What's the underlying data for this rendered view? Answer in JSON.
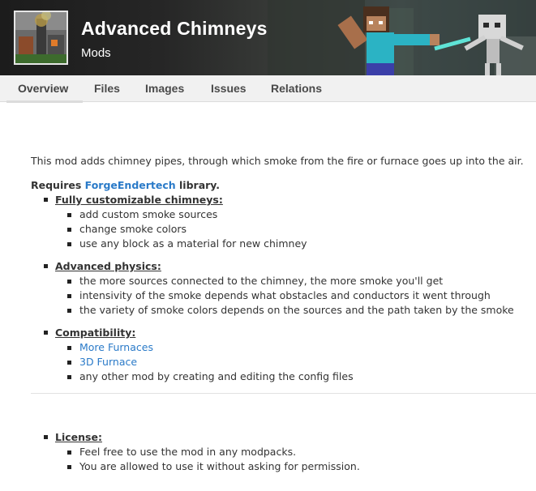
{
  "header": {
    "title": "Advanced Chimneys",
    "category": "Mods"
  },
  "tabs": [
    {
      "label": "Overview"
    },
    {
      "label": "Files"
    },
    {
      "label": "Images"
    },
    {
      "label": "Issues"
    },
    {
      "label": "Relations"
    }
  ],
  "description": {
    "intro": "This mod adds chimney pipes, through which smoke from the fire or furnace goes up into the air.",
    "requires_prefix": "Requires ",
    "requires_link": "ForgeEndertech",
    "requires_suffix": " library.",
    "sections": [
      {
        "heading": "Fully customizable chimneys:",
        "items": [
          {
            "text": "add custom smoke sources"
          },
          {
            "text": "change smoke colors"
          },
          {
            "text": "use any block as a material for new chimney"
          }
        ]
      },
      {
        "heading": "Advanced physics:",
        "items": [
          {
            "text": "the more sources connected to the chimney, the more smoke you'll get"
          },
          {
            "text": "intensivity of the smoke depends what obstacles and conductors it went through"
          },
          {
            "text": "the variety of smoke colors depends on the sources and the path taken by the smoke"
          }
        ]
      },
      {
        "heading": "Compatibility:",
        "items": [
          {
            "text": "More Furnaces"
          },
          {
            "text": "3D Furnace"
          },
          {
            "text": "any other mod by creating and editing the config files"
          }
        ]
      },
      {
        "heading": "License:",
        "items": [
          {
            "text": "Feel free to use the mod in any modpacks."
          },
          {
            "text": "You are allowed to use it without asking for permission."
          }
        ]
      }
    ]
  },
  "colors": {
    "link": "#2a7ac8",
    "header_bg": "#262626",
    "tab_bg": "#f1f1f1"
  }
}
